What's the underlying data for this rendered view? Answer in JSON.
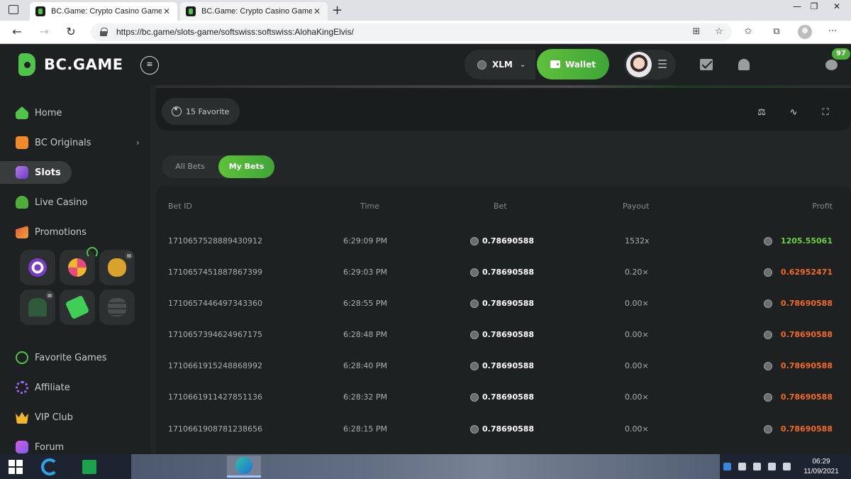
{
  "browser": {
    "tabs": [
      {
        "title": "BC.Game: Crypto Casino Games",
        "close": "✕"
      },
      {
        "title": "BC.Game: Crypto Casino Games",
        "close": "✕"
      }
    ],
    "new_tab": "+",
    "url": "https://bc.game/slots-game/softswiss:softswiss:AlohaKingElvis/",
    "window_controls": [
      "—",
      "❐",
      "✕"
    ],
    "more": "···"
  },
  "header": {
    "logo_text": "BC.GAME",
    "menu_icon": "≡",
    "currency": "XLM",
    "wallet_label": "Wallet",
    "chat_badge": "97"
  },
  "sidebar": {
    "items": [
      {
        "label": "Home",
        "icon": "home-icon"
      },
      {
        "label": "BC Originals",
        "icon": "dice-icon"
      },
      {
        "label": "Slots",
        "icon": "slots-icon"
      },
      {
        "label": "Live Casino",
        "icon": "joystick-icon"
      },
      {
        "label": "Promotions",
        "icon": "promotions-icon"
      },
      {
        "label": "Favorite Games",
        "icon": "star-icon"
      },
      {
        "label": "Affiliate",
        "icon": "affiliate-icon"
      },
      {
        "label": "VIP Club",
        "icon": "crown-icon"
      },
      {
        "label": "Forum",
        "icon": "forum-icon"
      }
    ],
    "originals_chevron": "›"
  },
  "game_bar": {
    "favorite_label": "15 Favorite",
    "controls": [
      "⚖",
      "∿",
      "⛶"
    ]
  },
  "bets": {
    "tabs": [
      "All Bets",
      "My Bets"
    ],
    "columns": [
      "Bet ID",
      "Time",
      "Bet",
      "Payout",
      "Profit"
    ],
    "rows": [
      {
        "id": "1710657528889430912",
        "time": "6:29:09 PM",
        "bet": "0.78690588",
        "payout": "1532x",
        "profit": "1205.55061",
        "profit_color": "#6fd036"
      },
      {
        "id": "1710657451887867399",
        "time": "6:29:03 PM",
        "bet": "0.78690588",
        "payout": "0.20×",
        "profit": "0.62952471",
        "profit_color": "#f56a21"
      },
      {
        "id": "1710657446497343360",
        "time": "6:28:55 PM",
        "bet": "0.78690588",
        "payout": "0.00×",
        "profit": "0.78690588",
        "profit_color": "#f56a21"
      },
      {
        "id": "1710657394624967175",
        "time": "6:28:48 PM",
        "bet": "0.78690588",
        "payout": "0.00×",
        "profit": "0.78690588",
        "profit_color": "#f56a21"
      },
      {
        "id": "1710661915248868992",
        "time": "6:28:40 PM",
        "bet": "0.78690588",
        "payout": "0.00×",
        "profit": "0.78690588",
        "profit_color": "#f56a21"
      },
      {
        "id": "1710661911427851136",
        "time": "6:28:32 PM",
        "bet": "0.78690588",
        "payout": "0.00×",
        "profit": "0.78690588",
        "profit_color": "#f56a21"
      },
      {
        "id": "1710661908781238656",
        "time": "6:28:15 PM",
        "bet": "0.78690588",
        "payout": "0.00×",
        "profit": "0.78690588",
        "profit_color": "#f56a21"
      }
    ]
  },
  "taskbar": {
    "time": "06:29",
    "date": "11/09/2021",
    "ie_letter": "e"
  },
  "colors": {
    "accent_green": "#4fc34a",
    "loss_orange": "#f56a21",
    "win_green": "#6fd036"
  }
}
